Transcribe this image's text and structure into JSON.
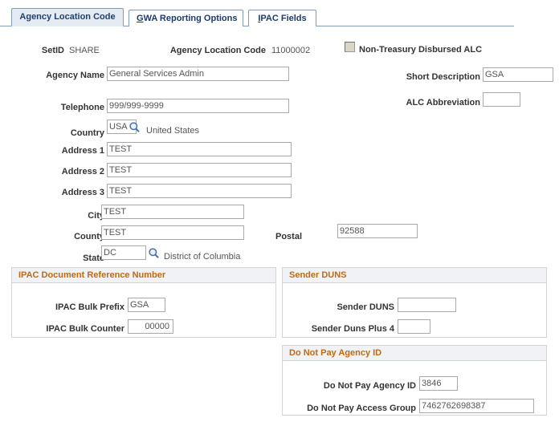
{
  "tabs": [
    {
      "label": "Agency Location Code",
      "accel": "",
      "active": true
    },
    {
      "label": "GWA Reporting Options",
      "accel": "G",
      "active": false
    },
    {
      "label": "IPAC Fields",
      "accel": "I",
      "active": false
    }
  ],
  "header": {
    "setid_label": "SetID",
    "setid_value": "SHARE",
    "alc_label": "Agency Location Code",
    "alc_value": "11000002",
    "non_treasury_label": "Non-Treasury Disbursed ALC",
    "non_treasury_checked": false
  },
  "fields": {
    "agency_name_label": "Agency Name",
    "agency_name_value": "General Services Admin",
    "short_description_label": "Short Description",
    "short_description_value": "GSA",
    "telephone_label": "Telephone",
    "telephone_value": "999/999-9999",
    "alc_abbreviation_label": "ALC Abbreviation",
    "alc_abbreviation_value": "",
    "country_label": "Country",
    "country_value": "USA",
    "country_description": "United States",
    "address1_label": "Address 1",
    "address1_value": "TEST",
    "address2_label": "Address 2",
    "address2_value": "TEST",
    "address3_label": "Address 3",
    "address3_value": "TEST",
    "city_label": "City",
    "city_value": "TEST",
    "county_label": "County",
    "county_value": "TEST",
    "postal_label": "Postal",
    "postal_value": "92588",
    "state_label": "State",
    "state_value": "DC",
    "state_description": "District of Columbia"
  },
  "panels": {
    "ipac": {
      "title": "IPAC Document Reference Number",
      "bulk_prefix_label": "IPAC Bulk Prefix",
      "bulk_prefix_value": "GSA",
      "bulk_counter_label": "IPAC Bulk Counter",
      "bulk_counter_value": "00000"
    },
    "sender_duns": {
      "title": "Sender DUNS",
      "sender_duns_label": "Sender DUNS",
      "sender_duns_value": "",
      "sender_duns_plus4_label": "Sender Duns Plus 4",
      "sender_duns_plus4_value": ""
    },
    "do_not_pay": {
      "title": "Do Not Pay Agency ID",
      "agency_id_label": "Do Not Pay Agency ID",
      "agency_id_value": "3846",
      "access_group_label": "Do Not Pay Access Group",
      "access_group_value": "7462762698387"
    }
  },
  "icons": {
    "lookup": "magnifier-icon"
  },
  "colors": {
    "tab_active_bg": "#e4ebf3",
    "tab_border": "#7f9db9",
    "panel_header_text": "#c06a14",
    "panel_header_bg": "#f0f2f6",
    "label_text": "#333333",
    "value_text": "#555555"
  }
}
